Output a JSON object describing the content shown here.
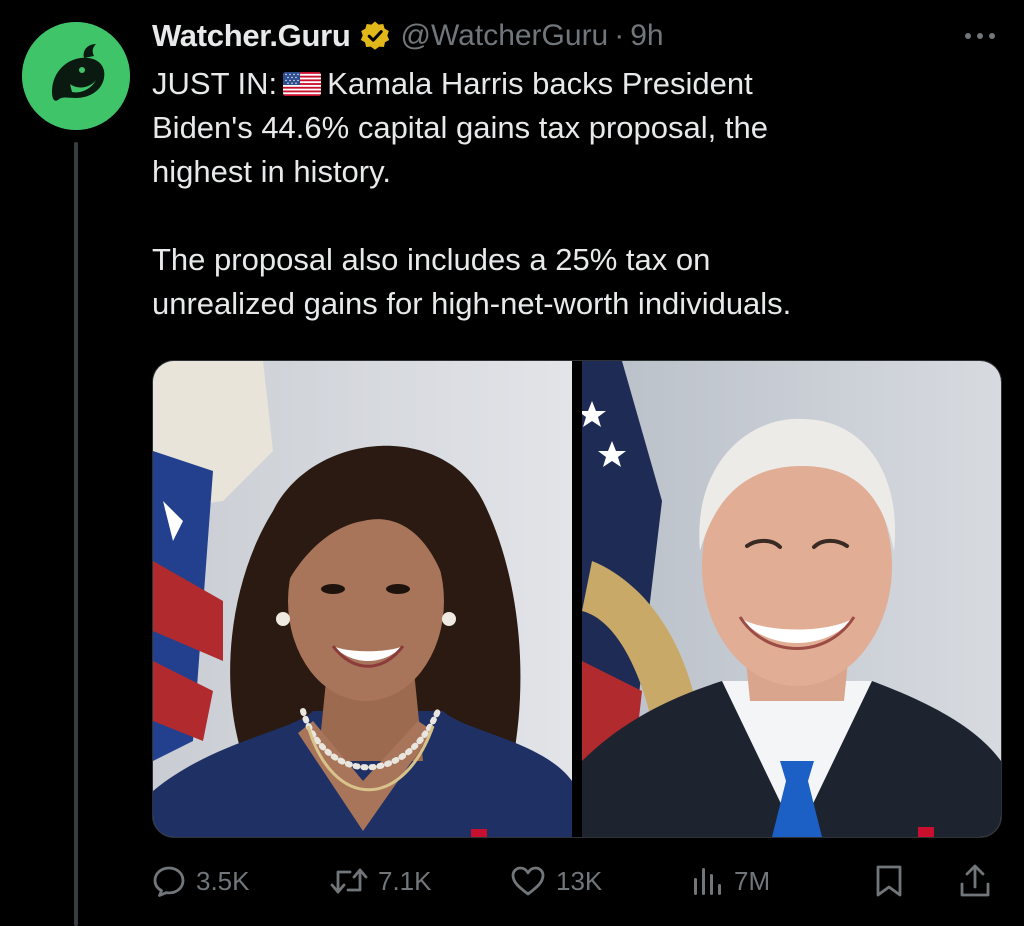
{
  "tweet": {
    "display_name": "Watcher.Guru",
    "handle": "@WatcherGuru",
    "separator": "·",
    "time": "9h",
    "avatar_icon": "whale-logo-icon",
    "verified_icon": "gold-verified-badge-icon",
    "more_icon": "more-options-icon",
    "text": {
      "line1_prefix": "JUST IN:",
      "line1_flag_icon": "us-flag-icon",
      "line1_suffix": "Kamala Harris backs President",
      "line2": "Biden's 44.6% capital gains tax proposal, the",
      "line3": "highest in history.",
      "line4": "The proposal also includes a 25% tax on",
      "line5": "unrealized gains for high-net-worth individuals."
    },
    "media": [
      {
        "name": "kamala-harris-portrait"
      },
      {
        "name": "joe-biden-portrait"
      }
    ]
  },
  "actions": {
    "replies": "3.5K",
    "reposts": "7.1K",
    "likes": "13K",
    "views": "7M",
    "reply_icon": "reply-icon",
    "repost_icon": "repost-icon",
    "like_icon": "heart-icon",
    "views_icon": "views-icon",
    "bookmark_icon": "bookmark-icon",
    "share_icon": "share-icon"
  },
  "colors": {
    "background": "#000000",
    "text_primary": "#e7e9ea",
    "text_secondary": "#71767b",
    "avatar_green": "#3fc46a",
    "verified_gold": "#e2b719"
  }
}
